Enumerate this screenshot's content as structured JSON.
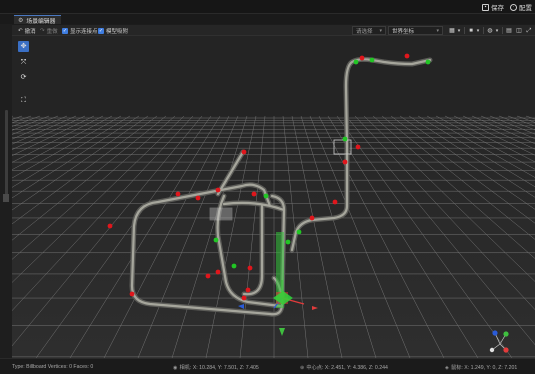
{
  "header": {
    "save_label": "保存",
    "settings_label": "配置"
  },
  "tab": {
    "title": "场景编辑器"
  },
  "toolbar": {
    "undo_label": "撤消",
    "redo_label": "重做",
    "show_connection_label": "显示连接点",
    "model_snap_label": "模型吸附",
    "select_placeholder": "请选择",
    "coord_mode": "世界坐标"
  },
  "status": {
    "object_info": "Type: Billboard Vertices: 0 Faces: 0",
    "camera_label": "相机:",
    "camera_value": "X: 10.284, Y: 7.501, Z: 7.405",
    "center_label": "中心点:",
    "center_value": "X: 2.451, Y: 4.386, Z: 0.244",
    "mouse_label": "鼠标:",
    "mouse_value": "X: 1.249, Y: 0, Z: 7.201"
  },
  "icons": {
    "save": "save-icon",
    "settings": "settings-icon",
    "tab": "gear-icon",
    "move": "move-icon",
    "scale": "scale-icon",
    "rotate": "rotate-icon",
    "frame": "frame-icon"
  },
  "colors": {
    "accent": "#3a6fc4",
    "background": "#1c1c1c",
    "grid": "#8a8a8a",
    "track": "#9d9d93",
    "node_red": "#e0161c",
    "node_green": "#21c624",
    "axis_x": "#e23b3b",
    "axis_y": "#3fbf3f",
    "axis_z": "#2a5bd8"
  }
}
